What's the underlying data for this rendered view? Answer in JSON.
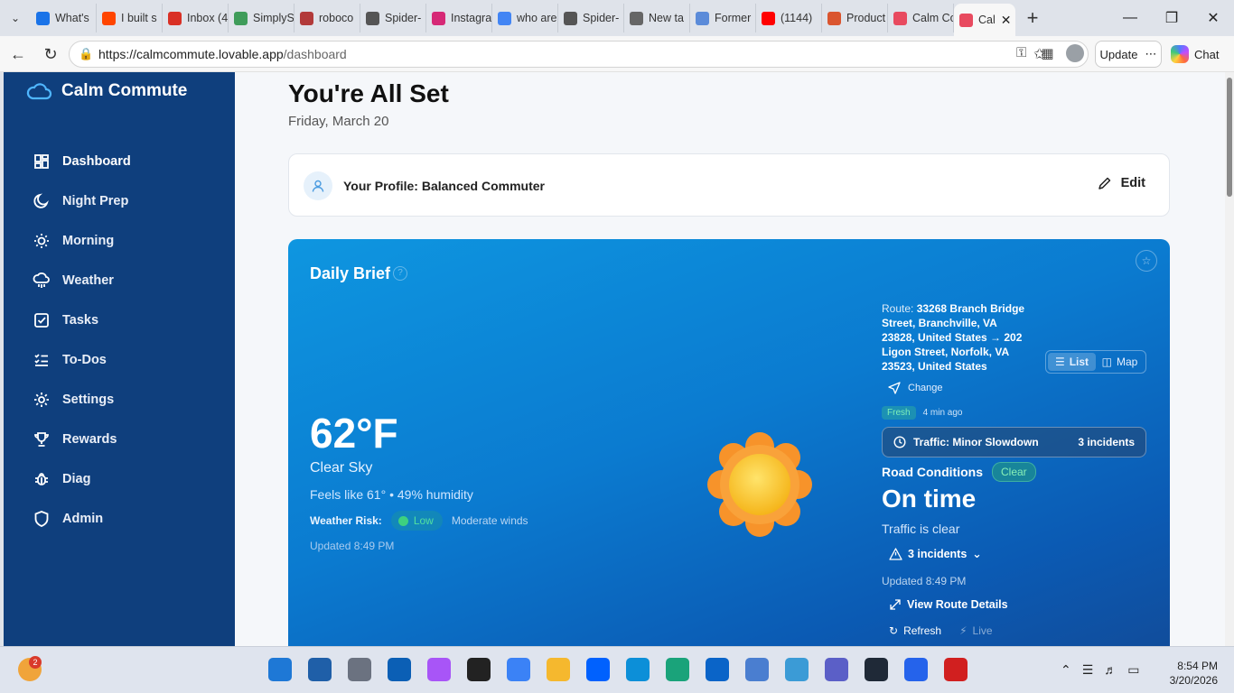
{
  "browser": {
    "tabs": [
      {
        "title": "What's",
        "color": "#1a73e8"
      },
      {
        "title": "I built s",
        "color": "#ff4500"
      },
      {
        "title": "Inbox (4",
        "color": "#d93025"
      },
      {
        "title": "SimplyS",
        "color": "#3f9c5a"
      },
      {
        "title": "roboco",
        "color": "#b23a3a"
      },
      {
        "title": "Spider-",
        "color": "#555555"
      },
      {
        "title": "Instagra",
        "color": "#d62976"
      },
      {
        "title": "who are",
        "color": "#4285f4"
      },
      {
        "title": "Spider-",
        "color": "#555555"
      },
      {
        "title": "New ta",
        "color": "#666666"
      },
      {
        "title": "Former",
        "color": "#5b8bd9"
      },
      {
        "title": "(1144)",
        "color": "#ff0000"
      },
      {
        "title": "Product",
        "color": "#da552f"
      },
      {
        "title": "Calm Co",
        "color": "#e84a5f"
      }
    ],
    "active_tab": {
      "title": "Cal",
      "color": "#e84a5f"
    },
    "url_host": "https://calmcommute.lovable.app",
    "url_path": "/dashboard",
    "update_label": "Update",
    "chat_label": "Chat"
  },
  "sidebar": {
    "brand": "Calm Commute",
    "items": [
      {
        "label": "Dashboard",
        "icon": "grid-icon"
      },
      {
        "label": "Night Prep",
        "icon": "moon-icon"
      },
      {
        "label": "Morning",
        "icon": "sun-icon"
      },
      {
        "label": "Weather",
        "icon": "cloud-rain-icon"
      },
      {
        "label": "Tasks",
        "icon": "checkbox-icon"
      },
      {
        "label": "To-Dos",
        "icon": "list-check-icon"
      },
      {
        "label": "Settings",
        "icon": "gear-icon"
      },
      {
        "label": "Rewards",
        "icon": "trophy-icon"
      },
      {
        "label": "Diag",
        "icon": "bug-icon"
      },
      {
        "label": "Admin",
        "icon": "shield-icon"
      }
    ]
  },
  "main": {
    "title": "You're All Set",
    "date": "Friday, March 20",
    "profile_label": "Your Profile: Balanced Commuter",
    "edit_label": "Edit"
  },
  "brief": {
    "title": "Daily Brief",
    "help": "?",
    "weather": {
      "temp": "62°F",
      "condition": "Clear Sky",
      "feels": "Feels like 61° • 49% humidity",
      "risk_label": "Weather Risk:",
      "risk_level": "Low",
      "risk_note": "Moderate winds",
      "updated": "Updated 8:49 PM"
    },
    "route": {
      "prefix": "Route:",
      "text": "33268 Branch Bridge Street, Branchville, VA 23828, United States → 202 Ligon Street, Norfolk, VA 23523, United States",
      "view_list": "List",
      "view_map": "Map",
      "change": "Change",
      "fresh": "Fresh",
      "fresh_time": "4 min ago",
      "traffic_label": "Traffic: Minor Slowdown",
      "traffic_incidents": "3 incidents",
      "road_label": "Road Conditions",
      "road_status": "Clear",
      "status": "On time",
      "status_note": "Traffic is clear",
      "incidents_dropdown": "3 incidents",
      "updated": "Updated 8:49 PM",
      "view_details": "View Route Details",
      "refresh": "Refresh",
      "live": "Live"
    }
  },
  "taskbar": {
    "weather_badge": "2",
    "time": "8:54 PM",
    "date": "3/20/2026"
  }
}
